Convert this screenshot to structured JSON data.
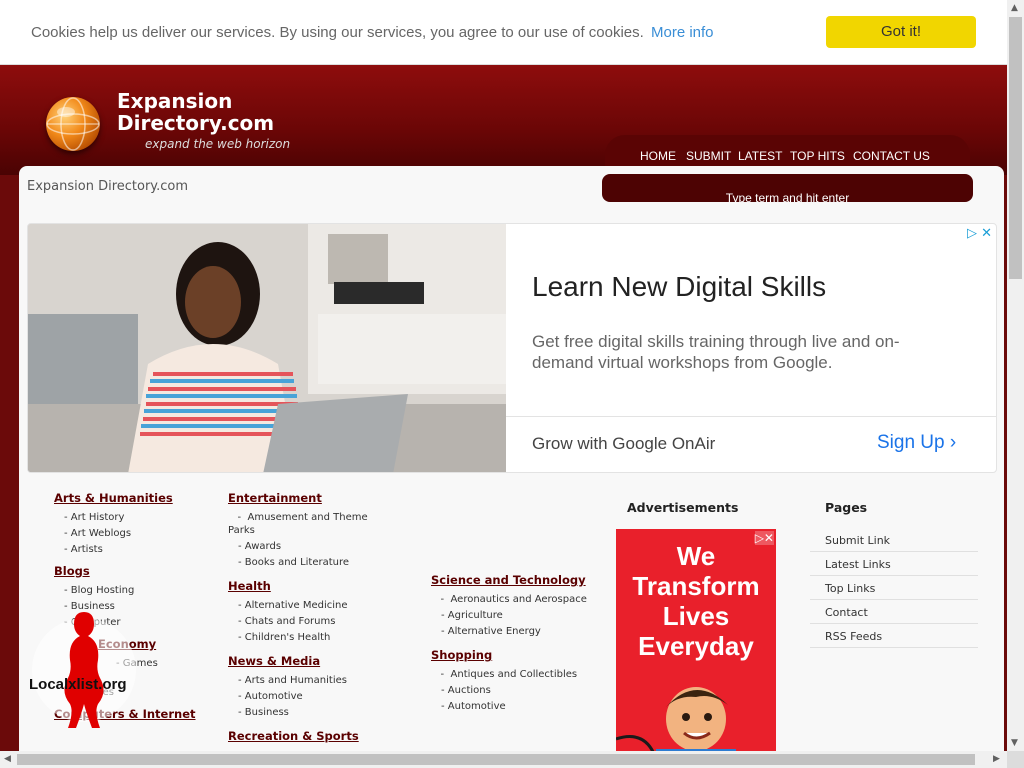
{
  "cookie": {
    "message": "Cookies help us deliver our services. By using our services, you agree to our use of cookies.",
    "more_info": "More info",
    "button": "Got it!"
  },
  "site": {
    "title_line1": "Expansion",
    "title_line2": "Directory.com",
    "tagline": "expand the web horizon"
  },
  "nav": [
    "HOME",
    "SUBMIT",
    "LATEST",
    "TOP HITS",
    "CONTACT US"
  ],
  "breadcrumb": "Expansion Directory.com",
  "search": {
    "placeholder": "Type term and hit enter"
  },
  "ad": {
    "headline": "Learn New Digital Skills",
    "description": "Get free digital skills training through live and on-demand virtual workshops from Google.",
    "brand": "Grow with Google OnAir",
    "cta": "Sign Up"
  },
  "categories": {
    "arts": {
      "title": "Arts & Humanities",
      "items": [
        "Art History",
        "Art Weblogs",
        "Artists"
      ]
    },
    "blogs": {
      "title": "Blogs",
      "items": [
        "Blog Hosting",
        "Business",
        "Computer"
      ]
    },
    "economy": {
      "title": "Economy",
      "items": [
        "Games",
        "Libraries"
      ]
    },
    "computers": {
      "title": "Computers & Internet"
    },
    "entertainment": {
      "title": "Entertainment",
      "items": [
        "Amusement and Theme Parks",
        "Awards",
        "Books and Literature"
      ]
    },
    "health": {
      "title": "Health",
      "items": [
        "Alternative Medicine",
        "Chats and Forums",
        "Children's Health"
      ]
    },
    "news": {
      "title": "News & Media",
      "items": [
        "Arts and Humanities",
        "Automotive",
        "Business"
      ]
    },
    "recreation": {
      "title": "Recreation & Sports"
    },
    "science": {
      "title": "Science and Technology",
      "items": [
        "Aeronautics and Aerospace",
        "Agriculture",
        "Alternative Energy"
      ]
    },
    "shopping": {
      "title": "Shopping",
      "items": [
        "Antiques and Collectibles",
        "Auctions",
        "Automotive"
      ]
    }
  },
  "advertisements": {
    "title": "Advertisements",
    "banner_text": "We Transform Lives Everyday"
  },
  "pages": {
    "title": "Pages",
    "links": [
      "Submit Link",
      "Latest Links",
      "Top Links",
      "Contact",
      "RSS Feeds"
    ]
  },
  "watermark": "Localxlist.org",
  "colors": {
    "header": "#6b0a0a",
    "accent": "#5a0000",
    "cookie_button": "#f1d600",
    "link": "#3a8ed6",
    "ad_cta": "#1a73e8"
  }
}
